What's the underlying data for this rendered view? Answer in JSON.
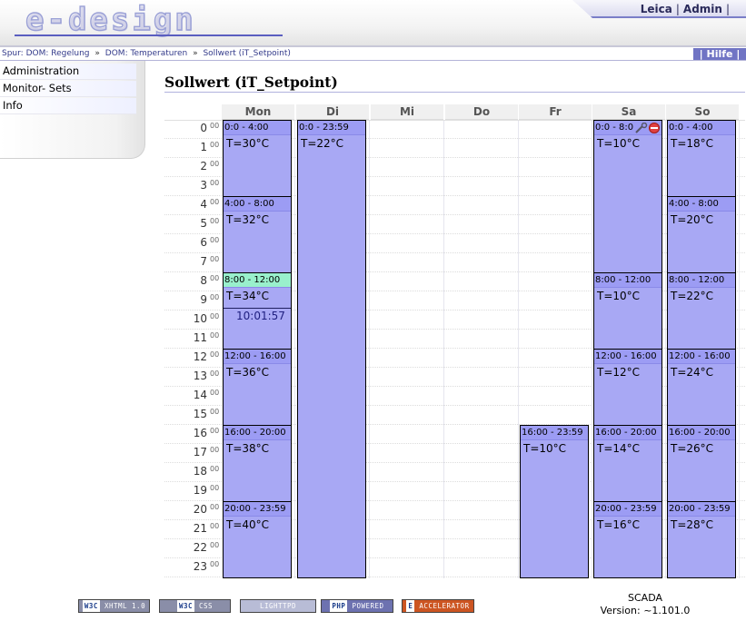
{
  "header": {
    "logo_text": "e-design",
    "user_name": "Leica",
    "admin_label": "Admin"
  },
  "breadcrumb": {
    "prefix": "Spur:",
    "items": [
      "DOM: Regelung",
      "DOM: Temperaturen",
      "Sollwert (iT_Setpoint)"
    ],
    "separator": "»"
  },
  "help_label": "| Hilfe |",
  "sidebar": {
    "items": [
      {
        "label": "Administration"
      },
      {
        "label": "Monitor- Sets"
      },
      {
        "label": "Info"
      }
    ]
  },
  "page_title": "Sollwert (iT_Setpoint)",
  "calendar": {
    "days": [
      "Mon",
      "Di",
      "Mi",
      "Do",
      "Fr",
      "Sa",
      "So"
    ],
    "hours": [
      "0",
      "1",
      "2",
      "3",
      "4",
      "5",
      "6",
      "7",
      "8",
      "9",
      "10",
      "11",
      "12",
      "13",
      "14",
      "15",
      "16",
      "17",
      "18",
      "19",
      "20",
      "21",
      "22",
      "23"
    ],
    "minute_label": "00",
    "current_time": "10:01:57",
    "blocks": [
      {
        "day": 0,
        "start": 0,
        "end": 4,
        "label": "0:0 - 4:00",
        "temp": "T=30°C"
      },
      {
        "day": 0,
        "start": 4,
        "end": 8,
        "label": "4:00 - 8:00",
        "temp": "T=32°C"
      },
      {
        "day": 0,
        "start": 8,
        "end": 12,
        "label": "8:00 - 12:00",
        "temp": "T=34°C",
        "active": true
      },
      {
        "day": 0,
        "start": 12,
        "end": 16,
        "label": "12:00 - 16:00",
        "temp": "T=36°C"
      },
      {
        "day": 0,
        "start": 16,
        "end": 20,
        "label": "16:00 - 20:00",
        "temp": "T=38°C"
      },
      {
        "day": 0,
        "start": 20,
        "end": 24,
        "label": "20:00 - 23:59",
        "temp": "T=40°C"
      },
      {
        "day": 1,
        "start": 0,
        "end": 24,
        "label": "0:0 - 23:59",
        "temp": "T=22°C"
      },
      {
        "day": 4,
        "start": 16,
        "end": 24,
        "label": "16:00 - 23:59",
        "temp": "T=10°C"
      },
      {
        "day": 5,
        "start": 0,
        "end": 8,
        "label": "0:0 - 8:0",
        "temp": "T=10°C",
        "icons": true
      },
      {
        "day": 5,
        "start": 8,
        "end": 12,
        "label": "8:00 - 12:00",
        "temp": "T=10°C"
      },
      {
        "day": 5,
        "start": 12,
        "end": 16,
        "label": "12:00 - 16:00",
        "temp": "T=12°C"
      },
      {
        "day": 5,
        "start": 16,
        "end": 20,
        "label": "16:00 - 20:00",
        "temp": "T=14°C"
      },
      {
        "day": 5,
        "start": 20,
        "end": 24,
        "label": "20:00 - 23:59",
        "temp": "T=16°C"
      },
      {
        "day": 6,
        "start": 0,
        "end": 4,
        "label": "0:0 - 4:00",
        "temp": "T=18°C"
      },
      {
        "day": 6,
        "start": 4,
        "end": 8,
        "label": "4:00 - 8:00",
        "temp": "T=20°C"
      },
      {
        "day": 6,
        "start": 8,
        "end": 12,
        "label": "8:00 - 12:00",
        "temp": "T=22°C"
      },
      {
        "day": 6,
        "start": 12,
        "end": 16,
        "label": "12:00 - 16:00",
        "temp": "T=24°C"
      },
      {
        "day": 6,
        "start": 16,
        "end": 20,
        "label": "16:00 - 20:00",
        "temp": "T=26°C"
      },
      {
        "day": 6,
        "start": 20,
        "end": 24,
        "label": "20:00 - 23:59",
        "temp": "T=28°C"
      }
    ]
  },
  "footer": {
    "badges": [
      {
        "lead": "W3C",
        "text": "XHTML 1.0",
        "color": "#8a8ea8"
      },
      {
        "lead": "W3C",
        "text": "CSS",
        "color": "#8a8ea8"
      },
      {
        "lead": "",
        "text": "LIGHTTPD",
        "color": "#b8bcd6"
      },
      {
        "lead": "PHP",
        "text": "POWERED",
        "color": "#6d72b0"
      },
      {
        "lead": "E",
        "text": "ACCELERATOR",
        "color": "#cc5522"
      }
    ],
    "app_name": "SCADA",
    "version": "Version: ~1.101.0"
  },
  "colors": {
    "block_fill": "#a8a8f4",
    "active_header": "#99f0cc",
    "accent": "#7074c4"
  }
}
